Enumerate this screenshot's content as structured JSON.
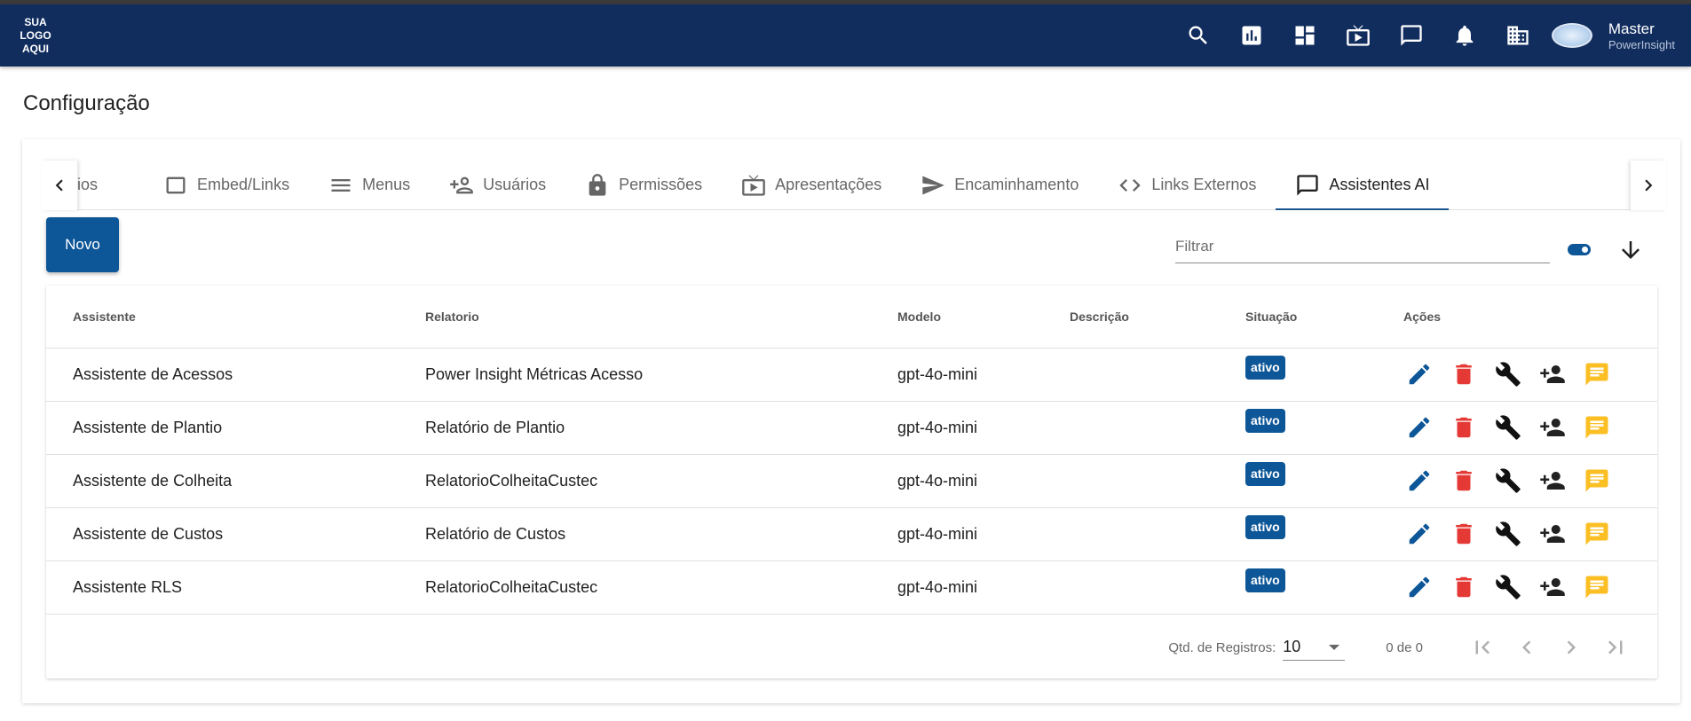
{
  "header": {
    "logo_lines": [
      "SUA",
      "LOGO",
      "AQUI"
    ],
    "icons": [
      "search-icon",
      "report-chart-icon",
      "dashboard-icon",
      "presentation-tv-icon",
      "chat-icon",
      "bell-icon",
      "building-icon"
    ],
    "user_name": "Master",
    "user_org": "PowerInsight"
  },
  "page": {
    "title": "Configuração"
  },
  "tabs": [
    {
      "label": "ios",
      "icon": "none",
      "partial": true
    },
    {
      "label": "Embed/Links",
      "icon": "embed-window-icon"
    },
    {
      "label": "Menus",
      "icon": "menu-icon"
    },
    {
      "label": "Usuários",
      "icon": "add-user-icon"
    },
    {
      "label": "Permissões",
      "icon": "lock-icon"
    },
    {
      "label": "Apresentações",
      "icon": "presentation-tv-icon"
    },
    {
      "label": "Encaminhamento",
      "icon": "send-icon"
    },
    {
      "label": "Links Externos",
      "icon": "code-icon"
    },
    {
      "label": "Assistentes AI",
      "icon": "chat-icon",
      "active": true
    }
  ],
  "toolbar": {
    "new_label": "Novo",
    "filter_placeholder": "Filtrar",
    "filter_value": ""
  },
  "table": {
    "columns": [
      "Assistente",
      "Relatorio",
      "Modelo",
      "Descrição",
      "Situação",
      "Ações"
    ],
    "rows": [
      {
        "assistente": "Assistente de Acessos",
        "relatorio": "Power Insight Métricas Acesso",
        "modelo": "gpt-4o-mini",
        "descricao": "",
        "situacao": "ativo"
      },
      {
        "assistente": "Assistente de Plantio",
        "relatorio": "Relatório de Plantio",
        "modelo": "gpt-4o-mini",
        "descricao": "",
        "situacao": "ativo"
      },
      {
        "assistente": "Assistente de Colheita",
        "relatorio": "RelatorioColheitaCustec",
        "modelo": "gpt-4o-mini",
        "descricao": "",
        "situacao": "ativo"
      },
      {
        "assistente": "Assistente de Custos",
        "relatorio": "Relatório de Custos",
        "modelo": "gpt-4o-mini",
        "descricao": "",
        "situacao": "ativo"
      },
      {
        "assistente": "Assistente RLS",
        "relatorio": "RelatorioColheitaCustec",
        "modelo": "gpt-4o-mini",
        "descricao": "",
        "situacao": "ativo"
      }
    ],
    "row_action_icons": [
      "edit-icon",
      "delete-icon",
      "wrench-icon",
      "add-user-icon",
      "message-icon"
    ]
  },
  "pagination": {
    "label": "Qtd. de Registros:",
    "page_size": "10",
    "range": "0 de 0"
  },
  "colors": {
    "topbar": "#112d5e",
    "primary": "#0d5697",
    "delete": "#e53935",
    "message": "#fbbf24"
  }
}
